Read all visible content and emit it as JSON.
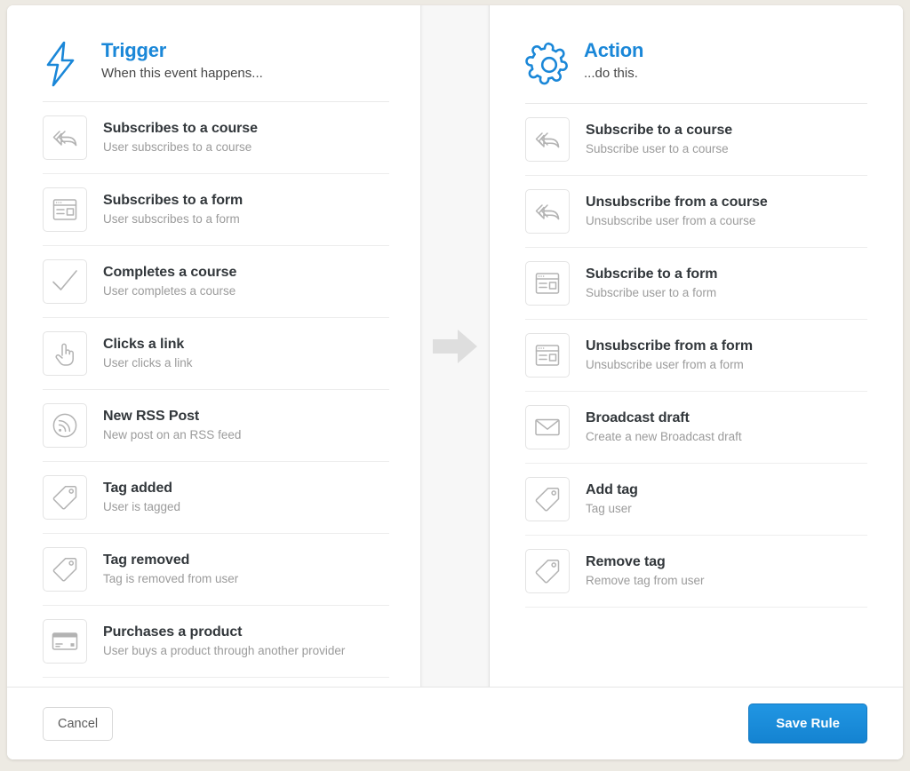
{
  "colors": {
    "accent_blue": "#1a87d8",
    "save_button_blue": "#1a8fdd",
    "page_background": "#edeae3",
    "icon_grey": "#b0b0b0",
    "arrow_grey": "#dedede"
  },
  "trigger": {
    "icon": "lightning-bolt-icon",
    "title": "Trigger",
    "subtitle": "When this event happens...",
    "items": [
      {
        "icon": "reply-all-arrow-icon",
        "title": "Subscribes to a course",
        "desc": "User subscribes to a course"
      },
      {
        "icon": "form-window-icon",
        "title": "Subscribes to a form",
        "desc": "User subscribes to a form"
      },
      {
        "icon": "checkmark-icon",
        "title": "Completes a course",
        "desc": "User completes a course"
      },
      {
        "icon": "pointing-hand-icon",
        "title": "Clicks a link",
        "desc": "User clicks a link"
      },
      {
        "icon": "rss-feed-icon",
        "title": "New RSS Post",
        "desc": "New post on an RSS feed"
      },
      {
        "icon": "tag-icon",
        "title": "Tag added",
        "desc": "User is tagged"
      },
      {
        "icon": "tag-icon",
        "title": "Tag removed",
        "desc": "Tag is removed from user"
      },
      {
        "icon": "credit-card-icon",
        "title": "Purchases a product",
        "desc": "User buys a product through another provider"
      }
    ]
  },
  "action": {
    "icon": "gear-icon",
    "title": "Action",
    "subtitle": "...do this.",
    "items": [
      {
        "icon": "reply-all-arrow-icon",
        "title": "Subscribe to a course",
        "desc": "Subscribe user to a course"
      },
      {
        "icon": "reply-all-arrow-icon",
        "title": "Unsubscribe from a course",
        "desc": "Unsubscribe user from a course"
      },
      {
        "icon": "form-window-icon",
        "title": "Subscribe to a form",
        "desc": "Subscribe user to a form"
      },
      {
        "icon": "form-window-icon",
        "title": "Unsubscribe from a form",
        "desc": "Unsubscribe user from a form"
      },
      {
        "icon": "envelope-icon",
        "title": "Broadcast draft",
        "desc": "Create a new Broadcast draft"
      },
      {
        "icon": "tag-icon",
        "title": "Add tag",
        "desc": "Tag user"
      },
      {
        "icon": "tag-icon",
        "title": "Remove tag",
        "desc": "Remove tag from user"
      }
    ]
  },
  "divider": {
    "icon": "right-arrow-icon"
  },
  "footer": {
    "cancel_label": "Cancel",
    "save_label": "Save Rule"
  }
}
